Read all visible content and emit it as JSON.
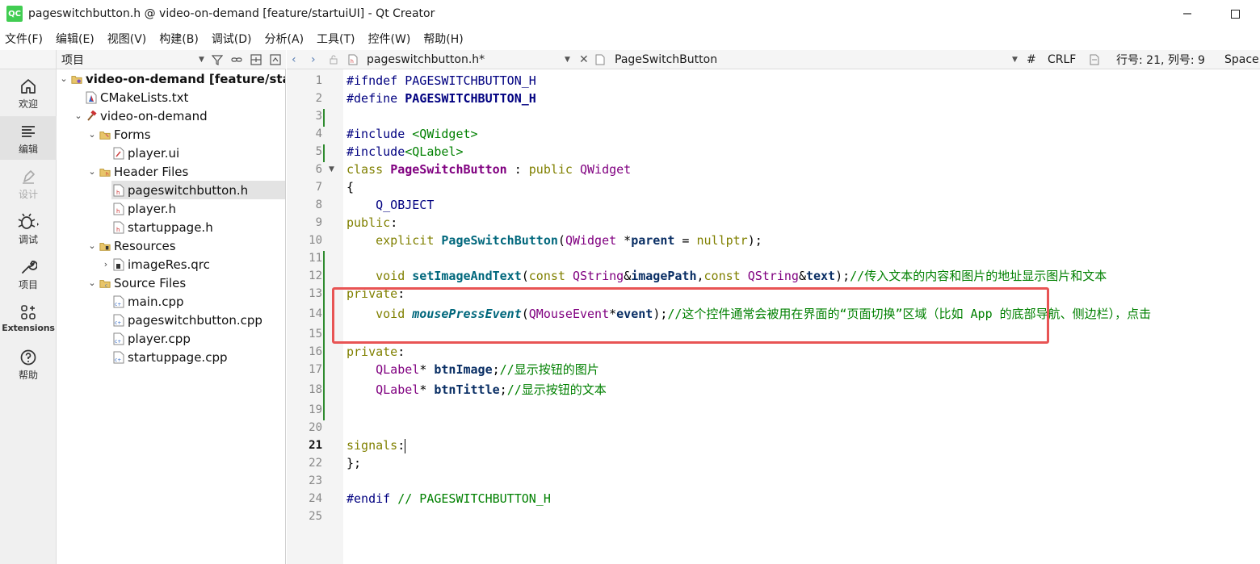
{
  "window": {
    "app_icon": "QC",
    "title": "pageswitchbutton.h @ video-on-demand [feature/startuiUI] - Qt Creator"
  },
  "menu": [
    "文件(F)",
    "编辑(E)",
    "视图(V)",
    "构建(B)",
    "调试(D)",
    "分析(A)",
    "工具(T)",
    "控件(W)",
    "帮助(H)"
  ],
  "modes": [
    {
      "label": "欢迎",
      "icon": "home-icon"
    },
    {
      "label": "编辑",
      "icon": "edit-lines-icon"
    },
    {
      "label": "设计",
      "icon": "pen-icon"
    },
    {
      "label": "调试",
      "icon": "bug-icon"
    },
    {
      "label": "项目",
      "icon": "wrench-icon"
    },
    {
      "label": "Extensions",
      "icon": "extensions-icon"
    },
    {
      "label": "帮助",
      "icon": "help-icon"
    }
  ],
  "project_panel": {
    "title": "项目",
    "tree": [
      {
        "label": "video-on-demand [feature/star",
        "depth": 0,
        "arrow": "down",
        "icon": "project-folder-icon"
      },
      {
        "label": "CMakeLists.txt",
        "depth": 1,
        "arrow": "",
        "icon": "cmake-icon"
      },
      {
        "label": "video-on-demand",
        "depth": 1,
        "arrow": "down",
        "icon": "hammer-icon"
      },
      {
        "label": "Forms",
        "depth": 2,
        "arrow": "down",
        "icon": "forms-folder-icon"
      },
      {
        "label": "player.ui",
        "depth": 3,
        "arrow": "",
        "icon": "ui-file-icon"
      },
      {
        "label": "Header Files",
        "depth": 2,
        "arrow": "down",
        "icon": "header-folder-icon"
      },
      {
        "label": "pageswitchbutton.h",
        "depth": 3,
        "arrow": "",
        "icon": "header-file-icon",
        "selected": true
      },
      {
        "label": "player.h",
        "depth": 3,
        "arrow": "",
        "icon": "header-file-icon"
      },
      {
        "label": "startuppage.h",
        "depth": 3,
        "arrow": "",
        "icon": "header-file-icon"
      },
      {
        "label": "Resources",
        "depth": 2,
        "arrow": "down",
        "icon": "resources-folder-icon"
      },
      {
        "label": "imageRes.qrc",
        "depth": 3,
        "arrow": "right",
        "icon": "qrc-file-icon"
      },
      {
        "label": "Source Files",
        "depth": 2,
        "arrow": "down",
        "icon": "source-folder-icon"
      },
      {
        "label": "main.cpp",
        "depth": 3,
        "arrow": "",
        "icon": "cpp-file-icon"
      },
      {
        "label": "pageswitchbutton.cpp",
        "depth": 3,
        "arrow": "",
        "icon": "cpp-file-icon"
      },
      {
        "label": "player.cpp",
        "depth": 3,
        "arrow": "",
        "icon": "cpp-file-icon"
      },
      {
        "label": "startuppage.cpp",
        "depth": 3,
        "arrow": "",
        "icon": "cpp-file-icon"
      }
    ]
  },
  "editor_toolbar": {
    "file_name": "pageswitchbutton.h*",
    "symbol": "PageSwitchButton",
    "hash": "#",
    "line_ending": "CRLF",
    "position": "行号: 21, 列号: 9",
    "indent": "Space"
  },
  "editor": {
    "current_line": 21,
    "line_numbers": [
      "1",
      "2",
      "3",
      "4",
      "5",
      "6",
      "7",
      "8",
      "9",
      "10",
      "11",
      "12",
      "13",
      "14",
      "15",
      "16",
      "17",
      "18",
      "19",
      "20",
      "21",
      "22",
      "23",
      "24",
      "25"
    ],
    "lines": [
      [
        [
          "pp",
          "#ifndef "
        ],
        [
          "macro",
          "PAGESWITCHBUTTON_H"
        ]
      ],
      [
        [
          "pp",
          "#define "
        ],
        [
          "pp b",
          "PAGESWITCHBUTTON_H"
        ]
      ],
      [],
      [
        [
          "pp",
          "#include "
        ],
        [
          "str",
          "<QWidget>"
        ]
      ],
      [
        [
          "pp",
          "#include"
        ],
        [
          "str",
          "<QLabel>"
        ]
      ],
      [
        [
          "kw",
          "class "
        ],
        [
          "ty b",
          "PageSwitchButton"
        ],
        [
          "plain",
          " : "
        ],
        [
          "kw",
          "public "
        ],
        [
          "ty",
          "QWidget"
        ]
      ],
      [
        [
          "plain",
          "{"
        ]
      ],
      [
        [
          "plain",
          "    "
        ],
        [
          "macro",
          "Q_OBJECT"
        ]
      ],
      [
        [
          "kw",
          "public"
        ],
        [
          "plain",
          ":"
        ]
      ],
      [
        [
          "plain",
          "    "
        ],
        [
          "kw",
          "explicit "
        ],
        [
          "fn",
          "PageSwitchButton"
        ],
        [
          "plain",
          "("
        ],
        [
          "ty",
          "QWidget"
        ],
        [
          "plain",
          " *"
        ],
        [
          "id",
          "parent"
        ],
        [
          "plain",
          " = "
        ],
        [
          "kw",
          "nullptr"
        ],
        [
          "plain",
          ");"
        ]
      ],
      [],
      [
        [
          "plain",
          "    "
        ],
        [
          "kw",
          "void "
        ],
        [
          "fn",
          "setImageAndText"
        ],
        [
          "plain",
          "("
        ],
        [
          "kw",
          "const "
        ],
        [
          "ty",
          "QString"
        ],
        [
          "plain",
          "&"
        ],
        [
          "id",
          "imagePath"
        ],
        [
          "plain",
          ","
        ],
        [
          "kw",
          "const "
        ],
        [
          "ty",
          "QString"
        ],
        [
          "plain",
          "&"
        ],
        [
          "id",
          "text"
        ],
        [
          "plain",
          ");"
        ],
        [
          "cm",
          "//传入文本的内容和图片的地址显示图片和文本"
        ]
      ],
      [
        [
          "kw",
          "private"
        ],
        [
          "plain",
          ":"
        ]
      ],
      [
        [
          "plain",
          "    "
        ],
        [
          "kw",
          "void "
        ],
        [
          "fn-i",
          "mousePressEvent"
        ],
        [
          "plain",
          "("
        ],
        [
          "ty",
          "QMouseEvent"
        ],
        [
          "plain",
          "*"
        ],
        [
          "id",
          "event"
        ],
        [
          "plain",
          ");"
        ],
        [
          "cm",
          "//这个控件通常会被用在界面的“页面切换”区域（比如 App 的底部导航、侧边栏），点击"
        ]
      ],
      [],
      [
        [
          "kw",
          "private"
        ],
        [
          "plain",
          ":"
        ]
      ],
      [
        [
          "plain",
          "    "
        ],
        [
          "ty",
          "QLabel"
        ],
        [
          "plain",
          "* "
        ],
        [
          "id",
          "btnImage"
        ],
        [
          "plain",
          ";"
        ],
        [
          "cm",
          "//显示按钮的图片"
        ]
      ],
      [
        [
          "plain",
          "    "
        ],
        [
          "ty",
          "QLabel"
        ],
        [
          "plain",
          "* "
        ],
        [
          "id",
          "btnTittle"
        ],
        [
          "plain",
          ";"
        ],
        [
          "cm",
          "//显示按钮的文本"
        ]
      ],
      [],
      [],
      [
        [
          "kw",
          "signals"
        ],
        [
          "plain",
          ":"
        ],
        [
          "cursor",
          ""
        ]
      ],
      [
        [
          "plain",
          "};"
        ]
      ],
      [],
      [
        [
          "pp",
          "#endif "
        ],
        [
          "cm",
          "// PAGESWITCHBUTTON_H"
        ]
      ],
      []
    ]
  },
  "colors": {
    "highlight_box": "#e85454",
    "change_bar": "#2e8b2e",
    "qt_green": "#41cd52"
  }
}
